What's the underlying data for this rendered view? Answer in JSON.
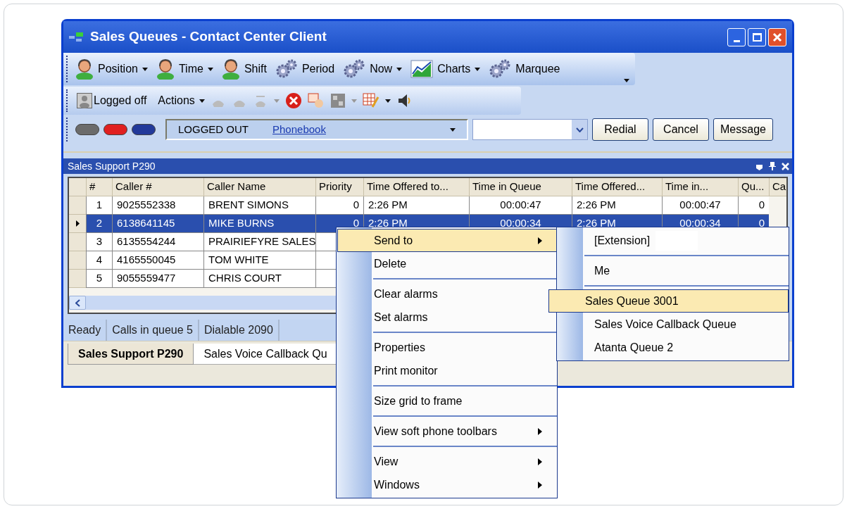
{
  "window": {
    "title": "Sales Queues - Contact Center Client"
  },
  "toolbar_main": [
    {
      "label": "Position",
      "kind": "person",
      "dropdown": true
    },
    {
      "label": "Time",
      "kind": "person",
      "dropdown": true
    },
    {
      "label": "Shift",
      "kind": "person",
      "dropdown": false
    },
    {
      "label": "Period",
      "kind": "gear",
      "dropdown": false
    },
    {
      "label": "Now",
      "kind": "gear",
      "dropdown": true
    },
    {
      "label": "Charts",
      "kind": "chart",
      "dropdown": true
    },
    {
      "label": "Marquee",
      "kind": "gear",
      "dropdown": false
    }
  ],
  "toolbar_actions": {
    "status_label": "Logged off",
    "menu_label": "Actions"
  },
  "phone_bar": {
    "lights": [
      {
        "color": "#6b6b6b"
      },
      {
        "color": "#e02020"
      },
      {
        "color": "#22399a"
      }
    ],
    "state": "LOGGED OUT",
    "link": "Phonebook",
    "buttons": [
      "Redial",
      "Cancel",
      "Message"
    ]
  },
  "panel": {
    "title": "Sales Support P290"
  },
  "grid": {
    "columns": [
      "#",
      "Caller #",
      "Caller Name",
      "Priority",
      "Time Offered to...",
      "Time in Queue",
      "Time Offered...",
      "Time  in...",
      "Qu...",
      "Ca"
    ],
    "rows": [
      {
        "selected": false,
        "cells": [
          "1",
          "9025552338",
          "BRENT SIMONS",
          "0",
          "2:26 PM",
          "00:00:47",
          "2:26 PM",
          "00:00:47",
          "0"
        ]
      },
      {
        "selected": true,
        "cells": [
          "2",
          "6138641145",
          "MIKE BURNS",
          "0",
          "2:26 PM",
          "00:00:34",
          "2:26 PM",
          "00:00:34",
          "0"
        ]
      },
      {
        "selected": false,
        "cells": [
          "3",
          "6135554244",
          "PRAIRIEFYRE SALES"
        ]
      },
      {
        "selected": false,
        "cells": [
          "4",
          "4165550045",
          "TOM WHITE"
        ]
      },
      {
        "selected": false,
        "cells": [
          "5",
          "9055559477",
          "CHRIS COURT"
        ]
      }
    ]
  },
  "status_bar": [
    "Ready",
    "Calls in queue 5",
    "Dialable 2090"
  ],
  "tabs": [
    {
      "label": "Sales Support P290",
      "selected": true
    },
    {
      "label": "Sales Voice Callback Qu",
      "selected": false
    }
  ],
  "context_menu": [
    {
      "kind": "item",
      "label": "Send to",
      "submenu": true,
      "selected": true
    },
    {
      "kind": "item",
      "label": "Delete",
      "submenu": false,
      "selected": false
    },
    {
      "kind": "separator"
    },
    {
      "kind": "item",
      "label": "Clear alarms",
      "submenu": false,
      "selected": false
    },
    {
      "kind": "item",
      "label": "Set alarms",
      "submenu": false,
      "selected": false
    },
    {
      "kind": "separator"
    },
    {
      "kind": "item",
      "label": "Properties",
      "submenu": false,
      "selected": false
    },
    {
      "kind": "item",
      "label": "Print monitor",
      "submenu": false,
      "selected": false
    },
    {
      "kind": "separator"
    },
    {
      "kind": "item",
      "label": "Size grid to frame",
      "submenu": false,
      "selected": false
    },
    {
      "kind": "separator"
    },
    {
      "kind": "item",
      "label": "View soft phone toolbars",
      "submenu": true,
      "selected": false
    },
    {
      "kind": "separator"
    },
    {
      "kind": "item",
      "label": "View",
      "submenu": true,
      "selected": false
    },
    {
      "kind": "item",
      "label": "Windows",
      "submenu": true,
      "selected": false
    }
  ],
  "submenu": [
    {
      "kind": "item",
      "label": "[Extension]",
      "selected": false
    },
    {
      "kind": "separator"
    },
    {
      "kind": "item",
      "label": "Me",
      "selected": false
    },
    {
      "kind": "separator"
    },
    {
      "kind": "item",
      "label": "Sales Queue 3001",
      "selected": true
    },
    {
      "kind": "item",
      "label": "Sales Voice Callback Queue",
      "selected": false
    },
    {
      "kind": "item",
      "label": "Atanta Queue 2",
      "selected": false
    }
  ]
}
